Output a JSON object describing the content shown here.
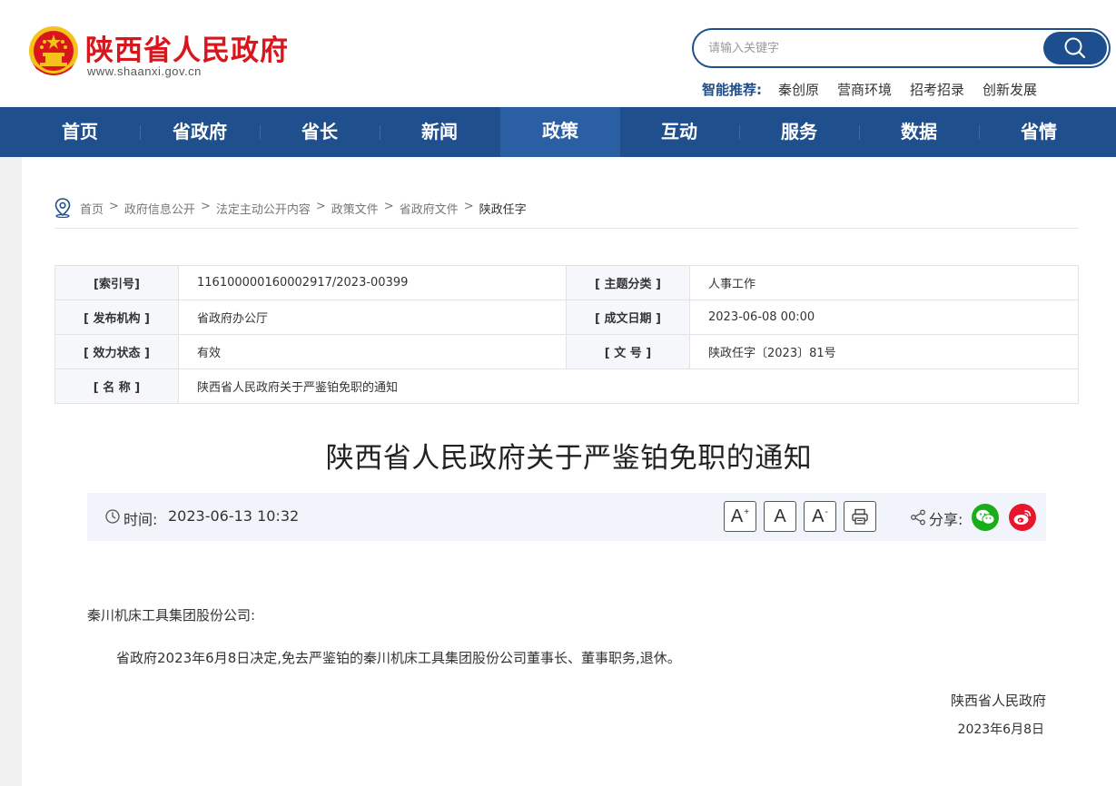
{
  "site": {
    "title": "陕西省人民政府",
    "url": "www.shaanxi.gov.cn"
  },
  "search": {
    "placeholder": "请输入关键字"
  },
  "recommend": {
    "label": "智能推荐:",
    "links": [
      "秦创原",
      "营商环境",
      "招考招录",
      "创新发展"
    ]
  },
  "nav": {
    "items": [
      "首页",
      "省政府",
      "省长",
      "新闻",
      "政策",
      "互动",
      "服务",
      "数据",
      "省情"
    ],
    "active": "政策"
  },
  "breadcrumb": [
    "首页",
    "政府信息公开",
    "法定主动公开内容",
    "政策文件",
    "省政府文件",
    "陕政任字"
  ],
  "breadcrumb_sep": ">",
  "meta": {
    "index_label": "[索引号]",
    "index_value": "116100000160002917/2023-00399",
    "topic_label": "[ 主题分类 ]",
    "topic_value": "人事工作",
    "issuer_label": "[ 发布机构 ]",
    "issuer_value": "省政府办公厅",
    "date_label": "[ 成文日期 ]",
    "date_value": "2023-06-08 00:00",
    "status_label": "[ 效力状态 ]",
    "status_value": "有效",
    "docno_label": "[ 文 号 ]",
    "docno_value": "陕政任字〔2023〕81号",
    "name_label": "[ 名 称 ]",
    "name_value": "陕西省人民政府关于严鉴铂免职的通知"
  },
  "article": {
    "title": "陕西省人民政府关于严鉴铂免职的通知",
    "time_label": "时间:",
    "time_value": "2023-06-13 10:32",
    "font_large": "A",
    "font_large_sup": "+",
    "font_normal": "A",
    "font_small": "A",
    "font_small_sup": "-",
    "share_label": "分享:",
    "salutation": "秦川机床工具集团股份公司:",
    "paragraph": "省政府2023年6月8日决定,免去严鉴铂的秦川机床工具集团股份公司董事长、董事职务,退休。",
    "signature": "陕西省人民政府",
    "sign_date": "2023年6月8日"
  },
  "colors": {
    "brand_red": "#d9161c",
    "nav_blue": "#1f4f8d",
    "wechat_green": "#1aad19",
    "weibo_red": "#e6162d"
  }
}
